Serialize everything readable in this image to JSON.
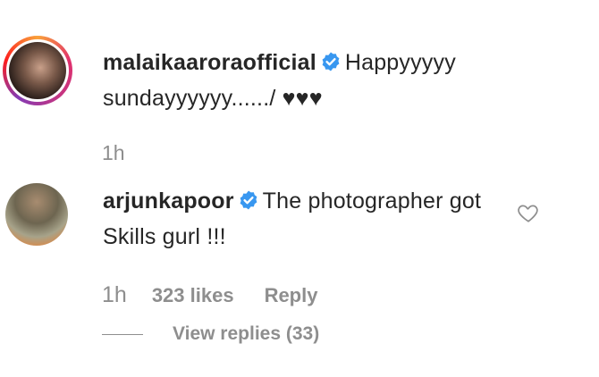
{
  "comments": [
    {
      "username": "malaikaaroraofficial",
      "text": "Happyyyyy sundayyyyyy....../ ♥♥♥",
      "time": "1h"
    },
    {
      "username": "arjunkapoor",
      "text": "The photographer got Skills gurl !!!",
      "time": "1h",
      "likes": "323 likes",
      "reply_label": "Reply",
      "view_replies": "View replies (33)"
    }
  ],
  "icons": {
    "verified": "verified-badge-icon",
    "like": "heart-outline-icon"
  },
  "colors": {
    "verified_blue": "#3897f0",
    "meta_gray": "#8e8e8e",
    "text": "#262626"
  }
}
